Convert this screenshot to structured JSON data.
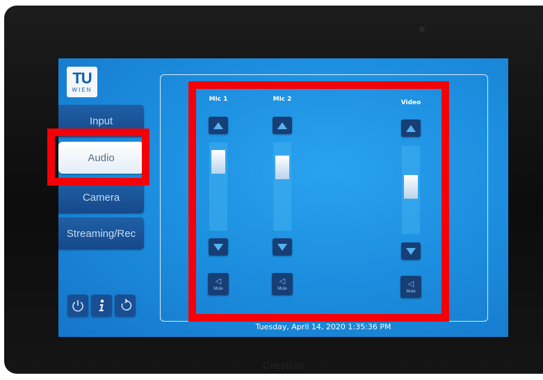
{
  "device": {
    "brand": "Crestron"
  },
  "logo": {
    "line1": "TU",
    "line2": "WIEN"
  },
  "nav": [
    {
      "label": "Input",
      "active": false
    },
    {
      "label": "Audio",
      "active": true
    },
    {
      "label": "Camera",
      "active": false
    },
    {
      "label": "Streaming/Rec",
      "active": false
    }
  ],
  "icons": {
    "power": "power-icon",
    "info": "info-icon",
    "reset": "reset-icon"
  },
  "channels": [
    {
      "label": "Mic 1",
      "mute_label": "Mute",
      "level": 0.88
    },
    {
      "label": "Mic 2",
      "mute_label": "Mute",
      "level": 0.8
    },
    {
      "label": "Video",
      "mute_label": "Mute",
      "level": 0.55
    }
  ],
  "status": {
    "datetime": "Tuesday, April 14, 2020 1:35:36 PM"
  },
  "colors": {
    "accent": "#1d8fe0",
    "highlight": "#f50008",
    "button": "#173f76"
  }
}
